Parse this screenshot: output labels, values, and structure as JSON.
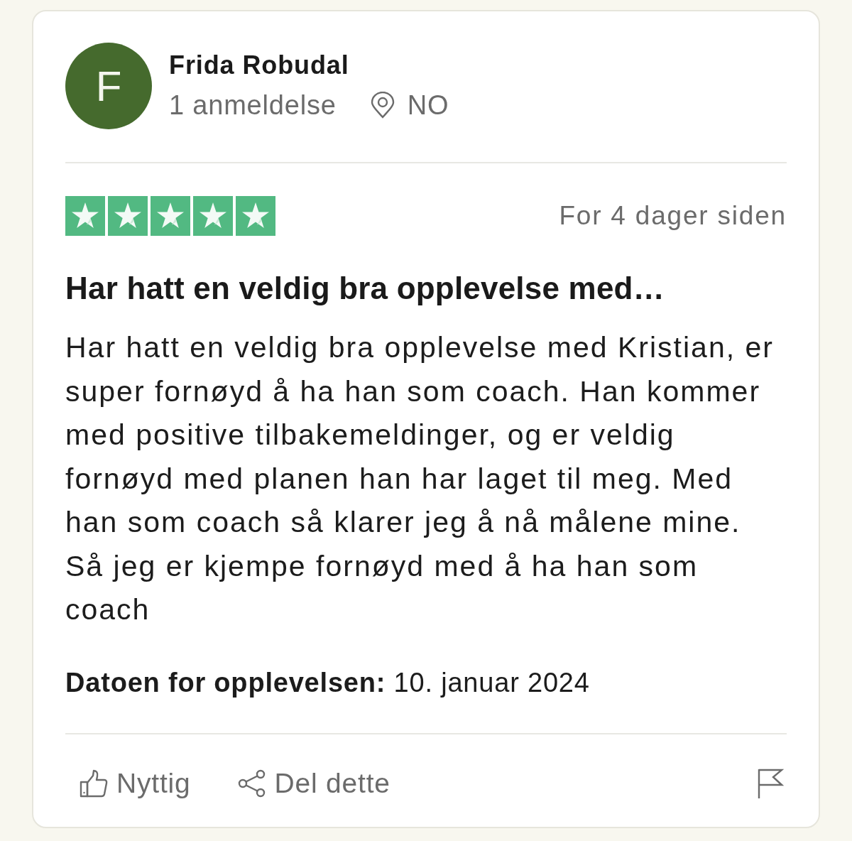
{
  "reviewer": {
    "initial": "F",
    "name": "Frida Robudal",
    "review_count": "1 anmeldelse",
    "country": "NO"
  },
  "review": {
    "stars": 5,
    "date": "For 4 dager siden",
    "title": "Har hatt en veldig bra opplevelse med…",
    "body": "Har hatt en veldig bra opplevelse med Kristian, er super fornøyd å ha han som coach. Han kommer med positive tilbakemeldinger, og er veldig fornøyd med planen han har laget til meg. Med han som coach så klarer jeg å nå målene mine. Så jeg er kjempe fornøyd med å ha han som coach",
    "experience_date": "**Datoen for opplevelsen:** 10. januar 2024"
  },
  "actions": [
    {
      "kind": "useful",
      "label": "Nyttig"
    },
    {
      "kind": "share",
      "label": "Del dette"
    },
    {
      "kind": "report"
    }
  ]
}
